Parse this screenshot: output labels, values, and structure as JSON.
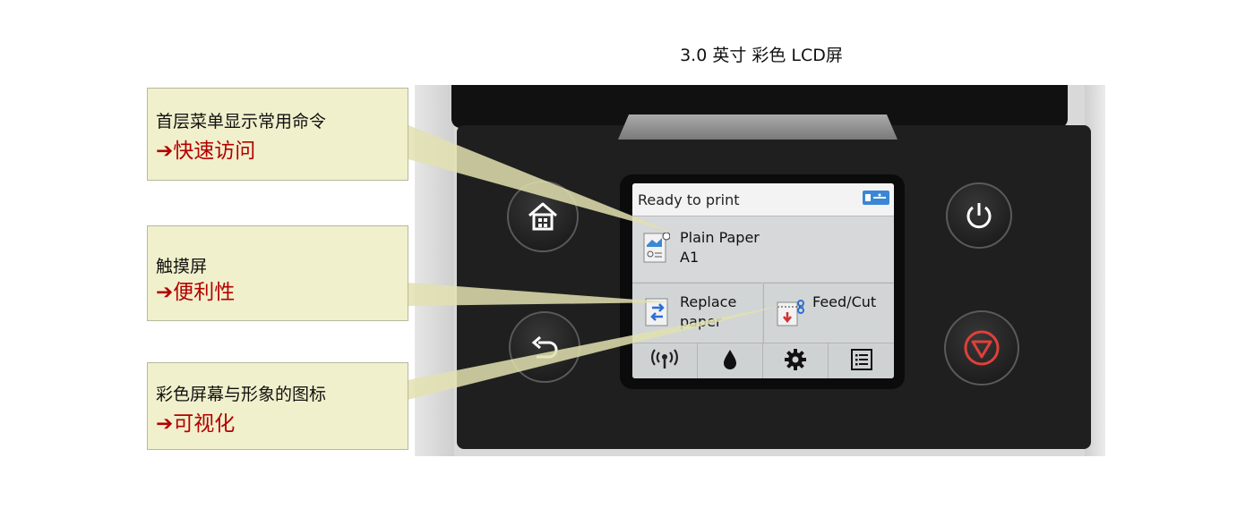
{
  "page": {
    "title": "3.0 英寸 彩色 LCD屏"
  },
  "callouts": [
    {
      "title": "首层菜单显示常用命令",
      "arrow": "➔",
      "benefit": "快速访问"
    },
    {
      "title": "触摸屏",
      "arrow": "➔",
      "benefit": "便利性"
    },
    {
      "title": "彩色屏幕与形象的图标",
      "arrow": "➔",
      "benefit": "可视化"
    }
  ],
  "lcd": {
    "status": "Ready to print",
    "status_icon": "usb-icon",
    "media": {
      "type": "Plain Paper",
      "size": "A1",
      "icon": "paper-media-icon"
    },
    "tiles": [
      {
        "label_1": "Replace",
        "label_2": "paper",
        "icon": "replace-paper-icon"
      },
      {
        "label_1": "Feed/Cut",
        "label_2": "",
        "icon": "feed-cut-icon"
      }
    ],
    "toolbar": [
      "wireless-icon",
      "ink-drop-icon",
      "gear-icon",
      "menu-list-icon"
    ]
  },
  "hardware_buttons": [
    "home-button",
    "back-button",
    "power-button",
    "stop-button"
  ],
  "colors": {
    "callout_bg": "#f1f0cc",
    "benefit_text": "#b30000",
    "stop_red": "#e0403a",
    "usb_blue": "#3b87d5"
  }
}
